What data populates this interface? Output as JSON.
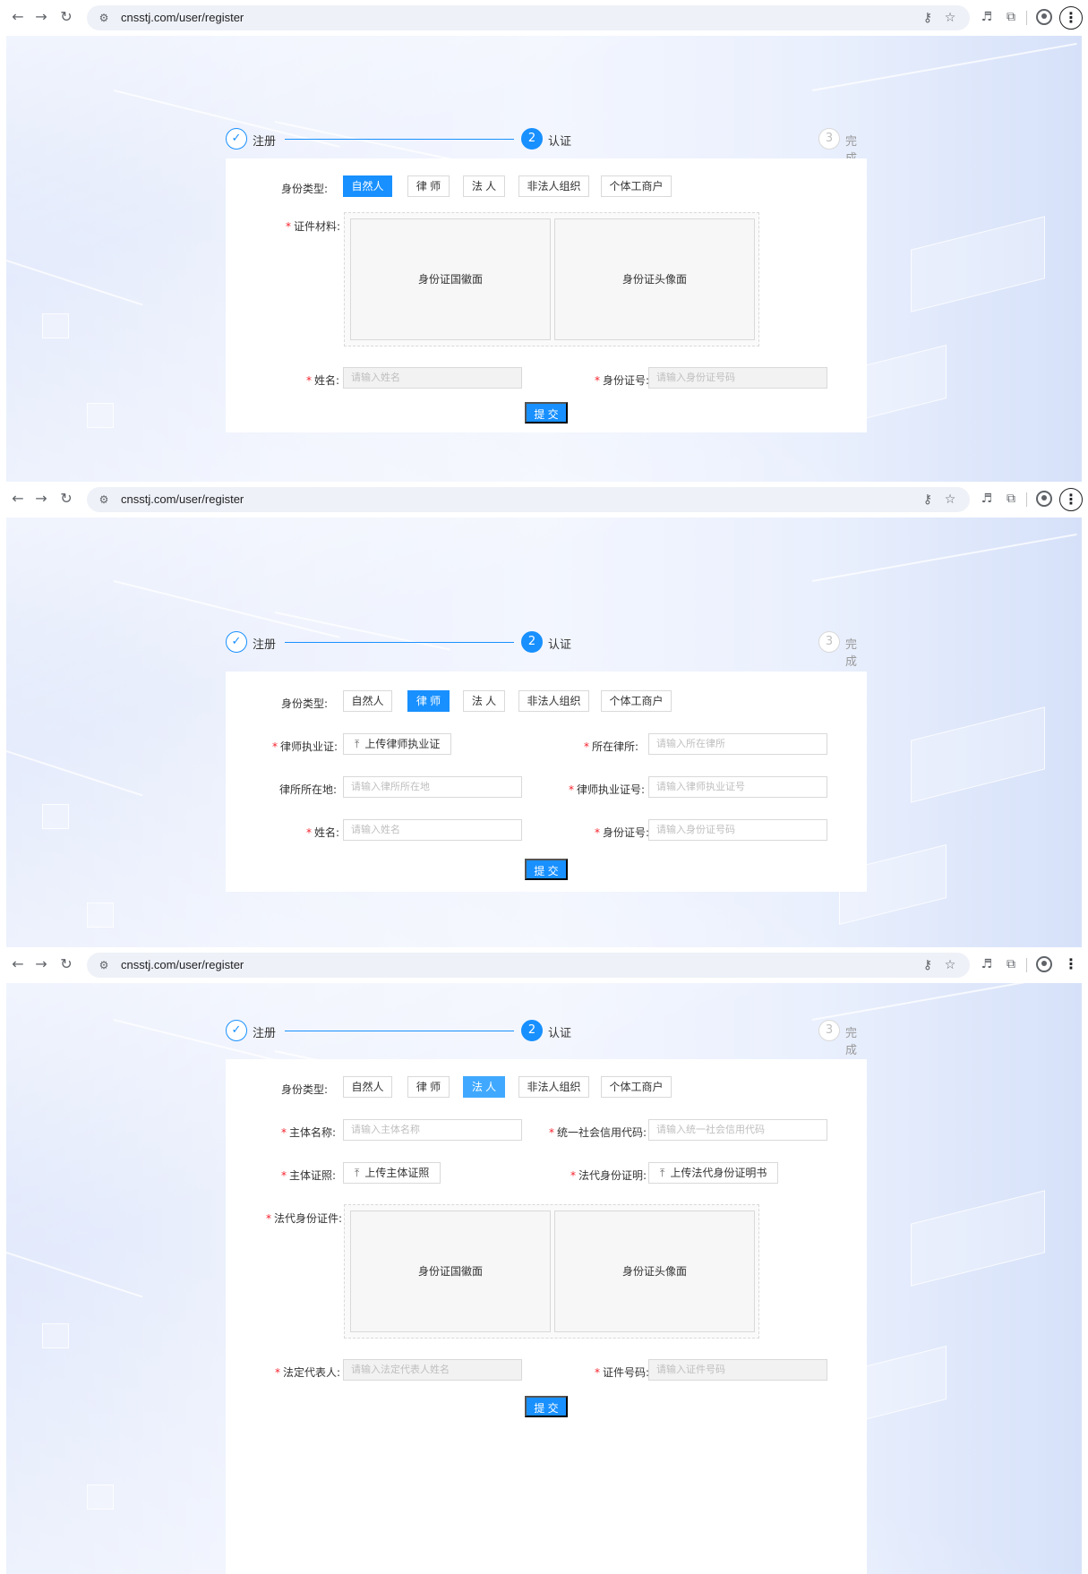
{
  "browser": {
    "url": "cnsstj.com/user/register",
    "icons": [
      "back-icon",
      "forward-icon",
      "reload-icon",
      "site-settings-icon",
      "password-key-icon",
      "star-icon",
      "extension-puzzle-icon",
      "profile-icon",
      "menu-icon"
    ]
  },
  "steps": {
    "step1_label": "注册",
    "step2_number": "2",
    "step2_label": "认证",
    "step3_number": "3",
    "step3_label": "完成"
  },
  "identity": {
    "label": "身份类型:",
    "types": [
      "自然人",
      "律 师",
      "法 人",
      "非法人组织",
      "个体工商户"
    ]
  },
  "natural_person": {
    "selected": "自然人",
    "docs_label": "证件材料:",
    "id_front": "身份证国徽面",
    "id_back": "身份证头像面",
    "name_label": "姓名:",
    "name_placeholder": "请输入姓名",
    "idno_label": "身份证号:",
    "idno_placeholder": "请输入身份证号码",
    "submit": "提 交"
  },
  "lawyer": {
    "selected": "律 师",
    "license_label": "律师执业证:",
    "license_upload": "上传律师执业证",
    "firm_label": "所在律所:",
    "firm_placeholder": "请输入所在律所",
    "firm_location_label": "律所所在地:",
    "firm_location_placeholder": "请输入律所所在地",
    "license_no_label": "律师执业证号:",
    "license_no_placeholder": "请输入律师执业证号",
    "name_label": "姓名:",
    "name_placeholder": "请输入姓名",
    "idno_label": "身份证号:",
    "idno_placeholder": "请输入身份证号码",
    "submit": "提 交"
  },
  "legal_person": {
    "selected": "法 人",
    "entity_name_label": "主体名称:",
    "entity_name_placeholder": "请输入主体名称",
    "credit_code_label": "统一社会信用代码:",
    "credit_code_placeholder": "请输入统一社会信用代码",
    "entity_cert_label": "主体证照:",
    "entity_cert_upload": "上传主体证照",
    "rep_proof_label": "法代身份证明:",
    "rep_proof_upload": "上传法代身份证明书",
    "rep_id_label": "法代身份证件:",
    "id_front": "身份证国徽面",
    "id_back": "身份证头像面",
    "rep_name_label": "法定代表人:",
    "rep_name_placeholder": "请输入法定代表人姓名",
    "cert_no_label": "证件号码:",
    "cert_no_placeholder": "请输入证件号码",
    "submit": "提 交"
  }
}
